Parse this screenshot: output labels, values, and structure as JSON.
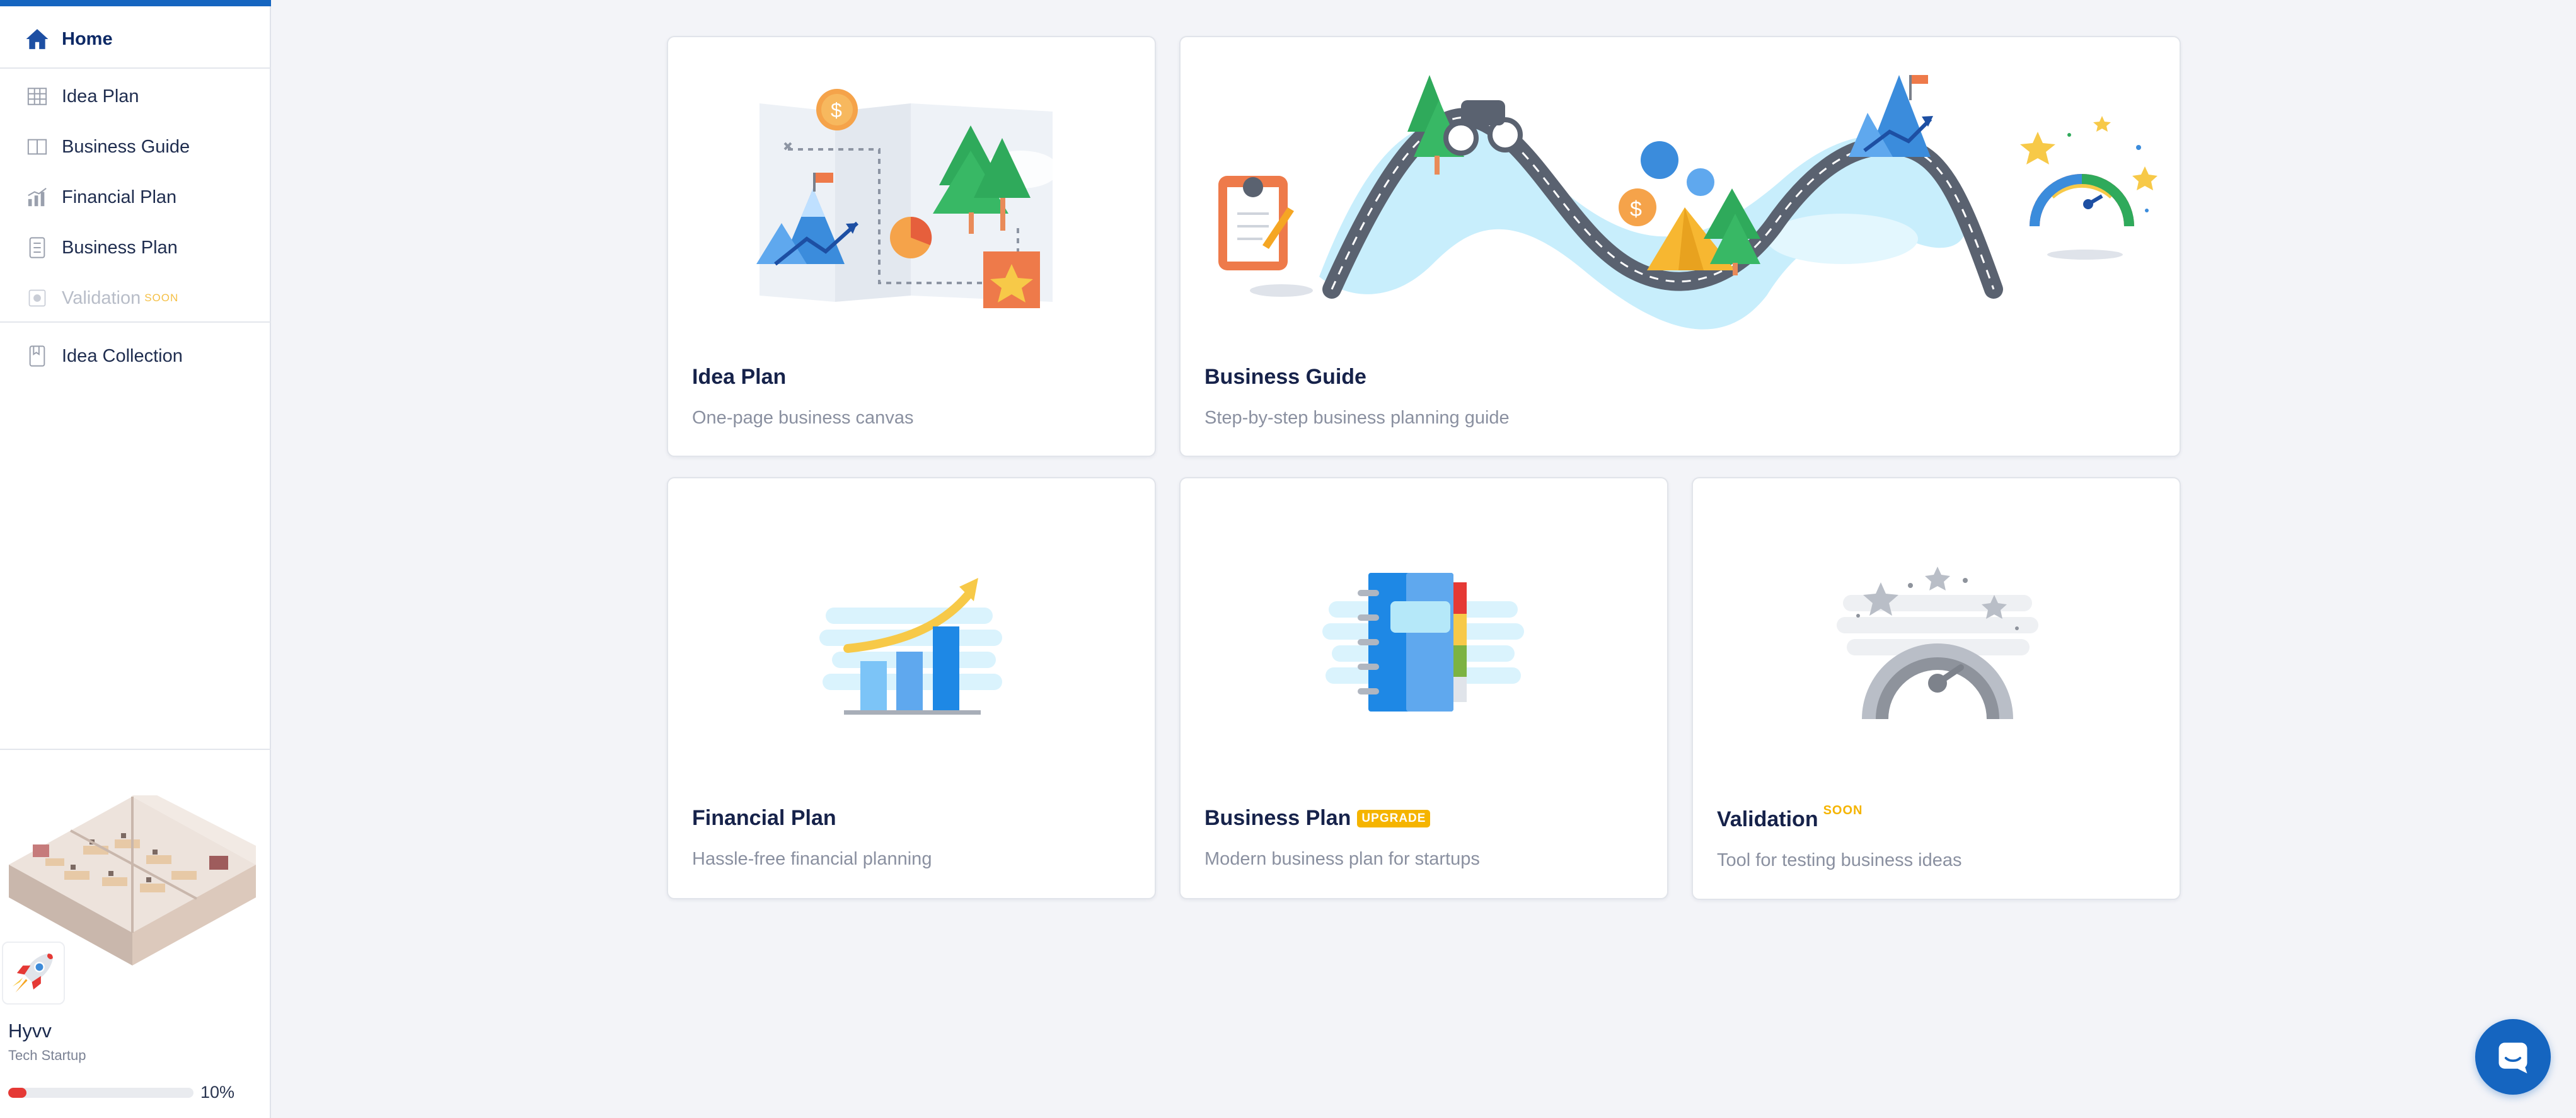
{
  "sidebar": {
    "items": [
      {
        "label": "Home",
        "icon": "home-icon"
      },
      {
        "label": "Idea Plan",
        "icon": "grid-icon"
      },
      {
        "label": "Business Guide",
        "icon": "book-icon"
      },
      {
        "label": "Financial Plan",
        "icon": "bar-chart-icon"
      },
      {
        "label": "Business Plan",
        "icon": "document-icon"
      },
      {
        "label": "Validation",
        "icon": "validation-icon",
        "badge": "SOON"
      },
      {
        "label": "Idea Collection",
        "icon": "bookmark-icon"
      }
    ]
  },
  "project": {
    "name": "Hyvv",
    "type": "Tech Startup",
    "progress_value": 0.1,
    "progress_label": "10%"
  },
  "cards": [
    {
      "title": "Idea Plan",
      "description": "One-page business canvas"
    },
    {
      "title": "Business Guide",
      "description": "Step-by-step business planning guide"
    },
    {
      "title": "Financial Plan",
      "description": "Hassle-free financial planning"
    },
    {
      "title": "Business Plan",
      "badge": "UPGRADE",
      "description": "Modern business plan for startups"
    },
    {
      "title": "Validation",
      "badge": "SOON",
      "description": "Tool for testing business ideas"
    }
  ],
  "colors": {
    "accent": "#1565c0",
    "progress": "#e53935",
    "badge": "#f5b400"
  }
}
